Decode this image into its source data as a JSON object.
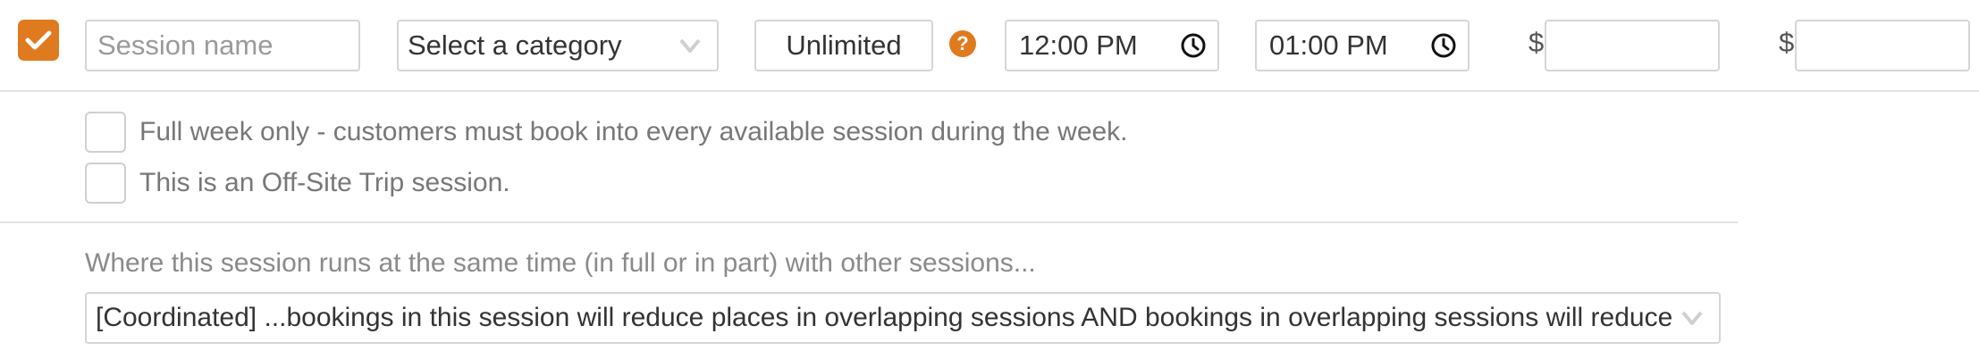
{
  "session": {
    "enabled": true,
    "name_placeholder": "Session name",
    "name_value": "",
    "category": {
      "selected": "Select a category"
    },
    "capacity_label": "Unlimited",
    "start_time": "12:00 PM",
    "end_time": "01:00 PM",
    "price_1": {
      "currency": "$",
      "value": ""
    },
    "price_2": {
      "currency": "$",
      "value": ""
    }
  },
  "options": [
    {
      "label": "Full week only - customers must book into every available session during the week.",
      "checked": false
    },
    {
      "label": "This is an Off-Site Trip session.",
      "checked": false
    }
  ],
  "overlap": {
    "label": "Where this session runs at the same time (in full or in part) with other sessions...",
    "selected": "[Coordinated] ...bookings in this session will reduce places in overlapping sessions AND bookings in overlapping sessions will reduce places in this session."
  },
  "icons": {
    "checkbox": "checkmark-icon",
    "help": "question-icon",
    "time": "clock-icon",
    "dropdown": "chevron-down-icon"
  },
  "colors": {
    "accent": "#e07a1f",
    "border": "#d5d5d5"
  }
}
